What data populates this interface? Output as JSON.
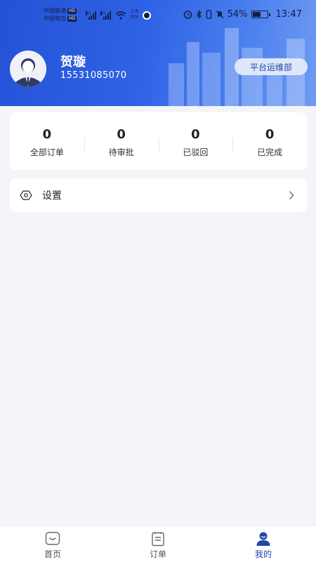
{
  "status_bar": {
    "carrier1": "中国联通",
    "carrier2": "中国电信",
    "hd": "HD",
    "net1": "4G",
    "net2": "4G",
    "speed_value": "1.6",
    "speed_unit": "K/s",
    "battery": "54%",
    "time": "13:47"
  },
  "profile": {
    "name": "贺璇",
    "phone": "15531085070",
    "department": "平台运维部"
  },
  "stats": [
    {
      "value": "0",
      "label": "全部订单"
    },
    {
      "value": "0",
      "label": "待审批"
    },
    {
      "value": "0",
      "label": "已驳回"
    },
    {
      "value": "0",
      "label": "已完成"
    }
  ],
  "menu": {
    "settings_label": "设置"
  },
  "tabs": [
    {
      "label": "首页",
      "icon": "home-icon"
    },
    {
      "label": "订单",
      "icon": "clipboard-icon"
    },
    {
      "label": "我的",
      "icon": "user-icon"
    }
  ],
  "colors": {
    "primary": "#2452d6",
    "active_tab": "#2346a8",
    "background": "#f4f5f9"
  }
}
